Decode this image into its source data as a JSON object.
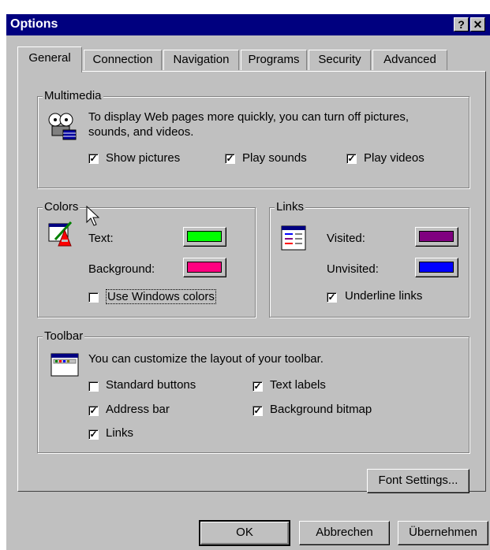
{
  "window": {
    "title": "Options",
    "help_glyph": "?",
    "close_glyph": "✕"
  },
  "tabs": [
    "General",
    "Connection",
    "Navigation",
    "Programs",
    "Security",
    "Advanced"
  ],
  "multimedia": {
    "label": "Multimedia",
    "description_line1": "To display Web pages more quickly, you can turn off pictures,",
    "description_line2": "sounds, and videos.",
    "show_pictures": "Show pictures",
    "play_sounds": "Play sounds",
    "play_videos": "Play videos",
    "show_pictures_checked": true,
    "play_sounds_checked": true,
    "play_videos_checked": true
  },
  "colors": {
    "label": "Colors",
    "text_label": "Text:",
    "background_label": "Background:",
    "use_windows_colors": "Use Windows colors",
    "use_windows_colors_checked": false,
    "text_color": "#00ff00",
    "background_color": "#ff0080"
  },
  "links": {
    "label": "Links",
    "visited_label": "Visited:",
    "unvisited_label": "Unvisited:",
    "underline_links": "Underline links",
    "underline_links_checked": true,
    "visited_color": "#800080",
    "unvisited_color": "#0000ff"
  },
  "toolbar": {
    "label": "Toolbar",
    "description": "You can customize the layout of your toolbar.",
    "standard_buttons": "Standard buttons",
    "address_bar": "Address bar",
    "links": "Links",
    "text_labels": "Text labels",
    "background_bitmap": "Background bitmap",
    "standard_buttons_checked": false,
    "address_bar_checked": true,
    "links_checked": true,
    "text_labels_checked": true,
    "background_bitmap_checked": true
  },
  "font_settings": "Font Settings...",
  "buttons": {
    "ok": "OK",
    "cancel": "Abbrechen",
    "apply": "Übernehmen"
  },
  "icons": {
    "multimedia": "film-reel-icon",
    "colors": "paint-brush-icon",
    "links": "link-page-icon",
    "toolbar": "toolbar-window-icon",
    "cursor": "mouse-pointer-icon"
  }
}
